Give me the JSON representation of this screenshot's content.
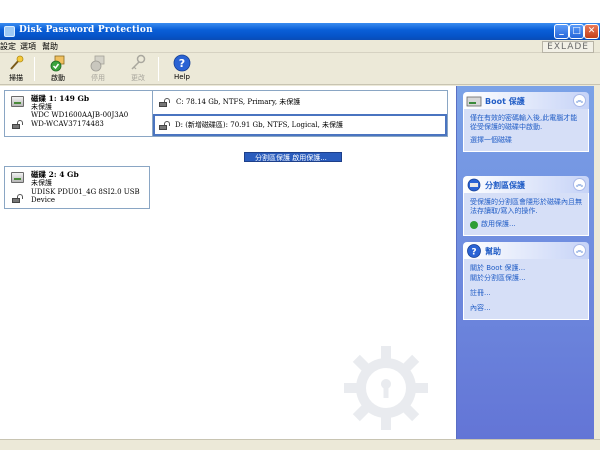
{
  "window": {
    "title": "Disk Password Protection",
    "brand": "EXLADE"
  },
  "menu": [
    "設定",
    "選項",
    "幫助"
  ],
  "toolbar": [
    {
      "label": "掃描",
      "icon": "wand-icon",
      "enabled": true
    },
    {
      "label": "啟動",
      "icon": "lock-check-icon",
      "enabled": true
    },
    {
      "label": "停用",
      "icon": "lock-disabled-icon",
      "enabled": false
    },
    {
      "label": "更改",
      "icon": "key-icon",
      "enabled": false
    },
    {
      "label": "Help",
      "icon": "help-icon",
      "enabled": true
    }
  ],
  "disks": [
    {
      "title": "磁碟 1: 149 Gb",
      "status": "未保護",
      "model": "WDC WD1600AAJB-00J3A0",
      "serial": "WD-WCAV37174483",
      "partitions": [
        {
          "text": "C: 78.14 Gb, NTFS, Primary, 未保護",
          "selected": false
        },
        {
          "text": "D: (新增磁碟區): 70.91 Gb, NTFS, Logical, 未保護",
          "selected": true
        }
      ]
    },
    {
      "title": "磁碟 2: 4 Gb",
      "status": "未保護",
      "model": "UDISK PDU01_4G 8SI2.0 USB Device",
      "serial": "",
      "partitions": []
    }
  ],
  "context_menu": "分割區保護 啟用保護...",
  "taskpane": {
    "boot": {
      "title": "Boot 保護",
      "text": "僅在有效的密碼輸入後,此電腦才能從受保護的磁碟中啟動.",
      "link": "選擇一個磁碟"
    },
    "partition": {
      "title": "分割區保護",
      "text": "受保護的分割區會隱形於磁碟內且無法存讀取/寫入的操作.",
      "link": "啟用保護..."
    },
    "help": {
      "title": "幫助",
      "links": [
        "關於 Boot 保護...",
        "關於分割區保護...",
        "註冊...",
        "內容..."
      ]
    }
  },
  "colors": {
    "titlebar": "#0a5fd8",
    "taskpane": "#6f8ce0",
    "link": "#215dc6",
    "selection": "#2a5cbd"
  }
}
